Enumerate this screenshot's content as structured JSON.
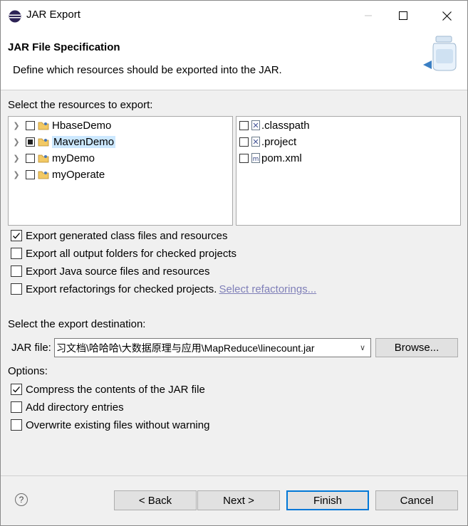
{
  "window": {
    "title": "JAR Export"
  },
  "header": {
    "title": "JAR File Specification",
    "description": "Define which resources should be exported into the JAR."
  },
  "resources": {
    "label": "Select the resources to export:",
    "projects": [
      {
        "name": "HbaseDemo",
        "state": "unchecked",
        "selected": false
      },
      {
        "name": "MavenDemo",
        "state": "partial",
        "selected": true
      },
      {
        "name": "myDemo",
        "state": "unchecked",
        "selected": false
      },
      {
        "name": "myOperate",
        "state": "unchecked",
        "selected": false
      }
    ],
    "files": [
      {
        "name": ".classpath",
        "icon": "xml-file-icon"
      },
      {
        "name": ".project",
        "icon": "xml-file-icon"
      },
      {
        "name": "pom.xml",
        "icon": "maven-pom-icon"
      }
    ]
  },
  "export_options": [
    {
      "label": "Export generated class files and resources",
      "checked": true
    },
    {
      "label": "Export all output folders for checked projects",
      "checked": false
    },
    {
      "label": "Export Java source files and resources",
      "checked": false
    },
    {
      "label": "Export refactorings for checked projects.",
      "checked": false,
      "link": "Select refactorings..."
    }
  ],
  "destination": {
    "label": "Select the export destination:",
    "jar_label": "JAR file:",
    "jar_value": "习文档\\哈哈哈\\大数据原理与应用\\MapReduce\\linecount.jar",
    "browse_label": "Browse..."
  },
  "options": {
    "label": "Options:",
    "items": [
      {
        "label": "Compress the contents of the JAR file",
        "checked": true
      },
      {
        "label": "Add directory entries",
        "checked": false
      },
      {
        "label": "Overwrite existing files without warning",
        "checked": false
      }
    ]
  },
  "footer": {
    "help": "?",
    "back": "< Back",
    "next": "Next >",
    "finish": "Finish",
    "cancel": "Cancel"
  },
  "colors": {
    "selection": "#cce8ff",
    "default_button_border": "#0078d7",
    "link": "#7f7fb8"
  }
}
